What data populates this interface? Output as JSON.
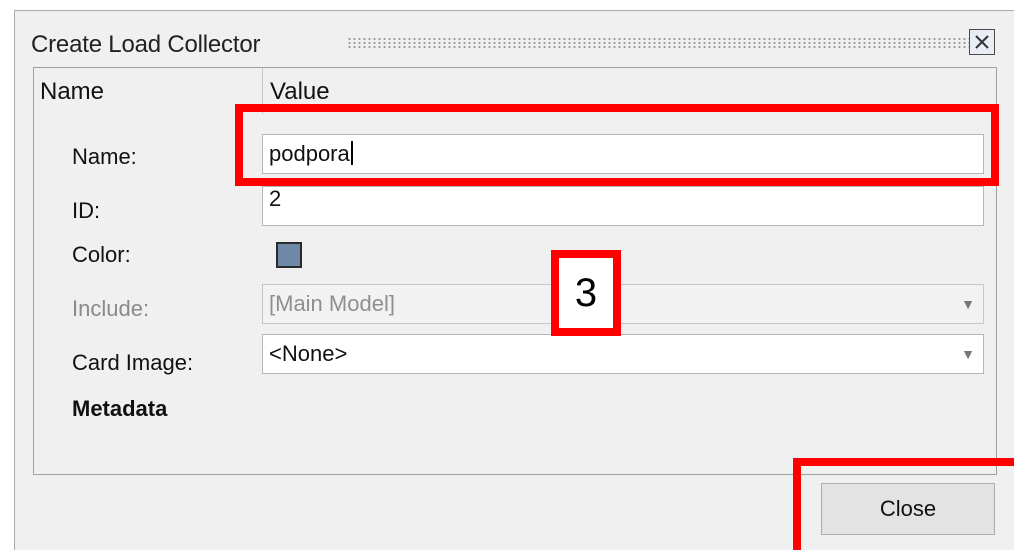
{
  "dialog": {
    "title": "Create Load Collector"
  },
  "table": {
    "col_name": "Name",
    "col_value": "Value"
  },
  "fields": {
    "name": {
      "label": "Name:",
      "value": "podpora"
    },
    "id": {
      "label": "ID:",
      "value": "2"
    },
    "color": {
      "label": "Color:",
      "swatch": "#6e88a8"
    },
    "include": {
      "label": "Include:",
      "value": "[Main Model]",
      "disabled": true
    },
    "card_image": {
      "label": "Card Image:",
      "value": "<None>"
    },
    "metadata": {
      "label": "Metadata"
    }
  },
  "buttons": {
    "close": "Close"
  },
  "annotation": {
    "step_number": "3",
    "highlight_color": "#ff0000"
  }
}
